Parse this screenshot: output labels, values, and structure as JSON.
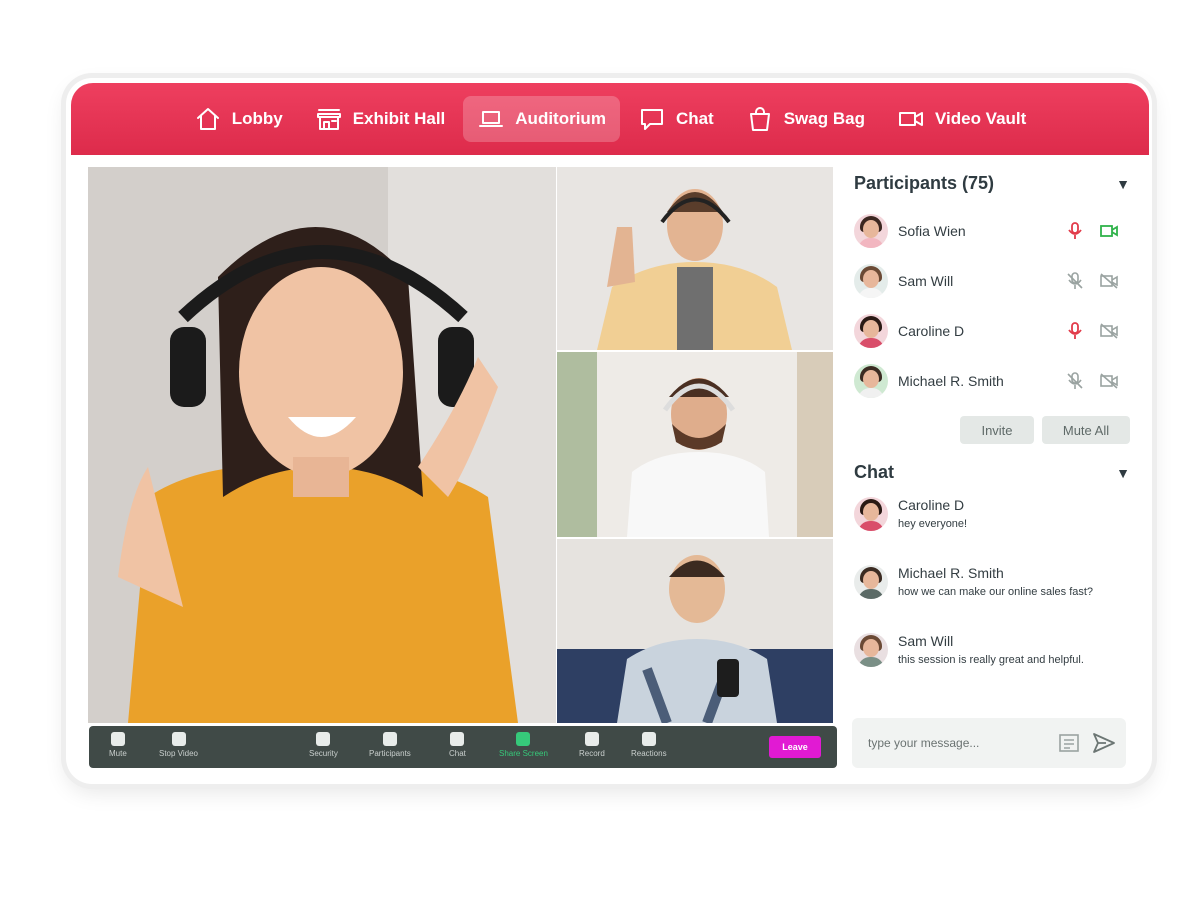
{
  "nav": {
    "items": [
      {
        "label": "Lobby",
        "icon": "home-icon"
      },
      {
        "label": "Exhibit Hall",
        "icon": "storefront-icon"
      },
      {
        "label": "Auditorium",
        "icon": "laptop-icon",
        "active": true
      },
      {
        "label": "Chat",
        "icon": "chat-bubble-icon"
      },
      {
        "label": "Swag Bag",
        "icon": "shopping-bag-icon"
      },
      {
        "label": "Video Vault",
        "icon": "video-camera-icon"
      }
    ],
    "accent": "#e63453"
  },
  "controls": {
    "items": [
      {
        "label": "Mute",
        "icon": "microphone-icon"
      },
      {
        "label": "Stop Video",
        "icon": "video-camera-icon"
      },
      {
        "label": "Security",
        "icon": "shield-icon"
      },
      {
        "label": "Participants",
        "icon": "people-icon"
      },
      {
        "label": "Chat",
        "icon": "chat-bubble-icon"
      },
      {
        "label": "Share Screen",
        "icon": "share-screen-icon",
        "active": true
      },
      {
        "label": "Record",
        "icon": "record-icon"
      },
      {
        "label": "Reactions",
        "icon": "emoji-icon"
      }
    ],
    "leave_label": "Leave",
    "bar_color": "#404a47",
    "leave_color": "#e11ad3"
  },
  "participants": {
    "title": "Participants (75)",
    "list": [
      {
        "name": "Sofia Wien",
        "mic": "on",
        "cam": "on"
      },
      {
        "name": "Sam Will",
        "mic": "off",
        "cam": "off"
      },
      {
        "name": "Caroline D",
        "mic": "on",
        "cam": "off"
      },
      {
        "name": "Michael R. Smith",
        "mic": "off",
        "cam": "off"
      }
    ],
    "invite_label": "Invite",
    "mute_all_label": "Mute All"
  },
  "chat": {
    "title": "Chat",
    "messages": [
      {
        "name": "Caroline D",
        "text": "hey everyone!"
      },
      {
        "name": "Michael R. Smith",
        "text": "how we can make our online sales fast?"
      },
      {
        "name": "Sam Will",
        "text": "this session is really great and helpful."
      }
    ],
    "input_placeholder": "type your message..."
  }
}
